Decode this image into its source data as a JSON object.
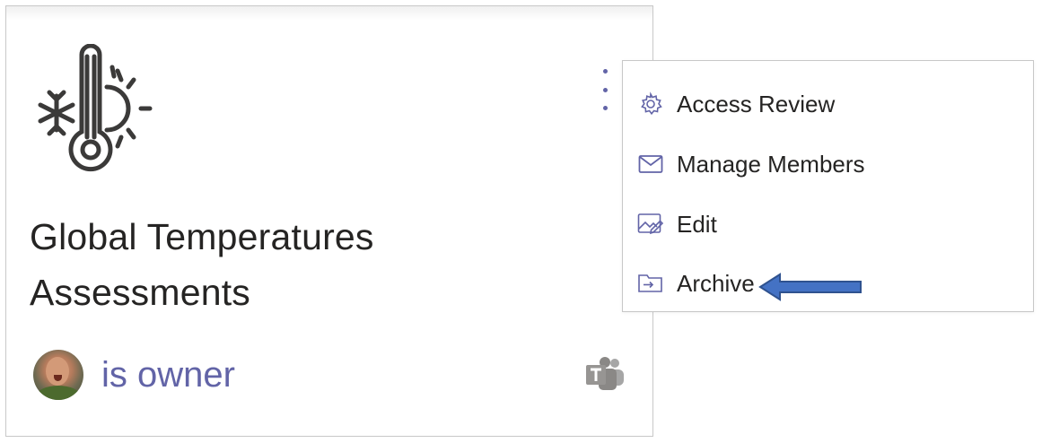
{
  "card": {
    "title_line1": "Global Temperatures",
    "title_line2": "Assessments",
    "owner_text": "is owner",
    "logo_icon": "thermometer-snowflake-sun-icon",
    "platform_icon": "microsoft-teams-icon",
    "more_icon": "more-vertical-icon"
  },
  "menu": {
    "items": [
      {
        "label": "Access Review",
        "icon": "gear-icon"
      },
      {
        "label": "Manage Members",
        "icon": "mail-icon"
      },
      {
        "label": "Edit",
        "icon": "edit-image-icon"
      },
      {
        "label": "Archive",
        "icon": "archive-icon"
      }
    ]
  },
  "colors": {
    "accent": "#6264a7",
    "text": "#252423",
    "icon_gray": "#484644",
    "arrow_fill": "#4472c4"
  }
}
